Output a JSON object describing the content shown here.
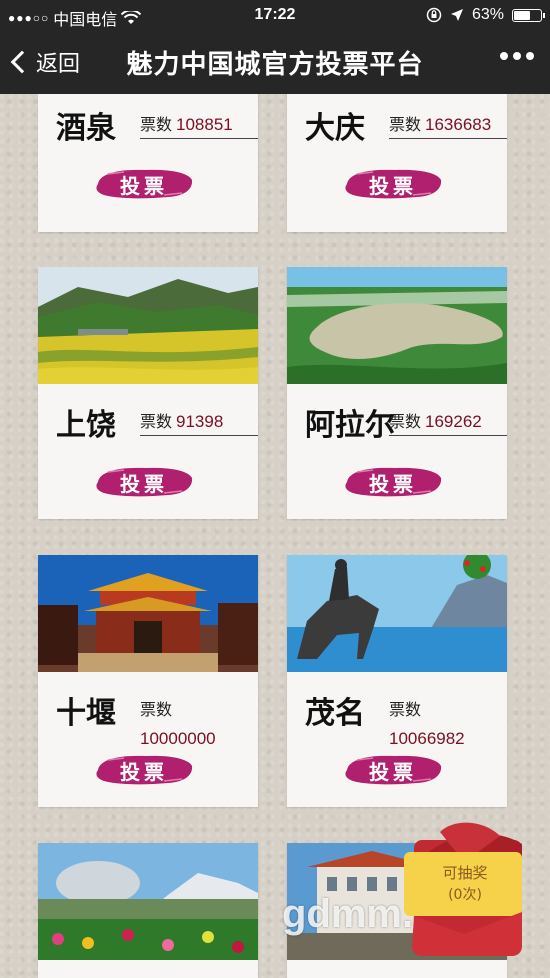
{
  "status_bar": {
    "carrier": "中国电信",
    "time": "17:22",
    "battery": "63%",
    "battery_level": 0.63
  },
  "nav": {
    "back_label": "返回",
    "title": "魅力中国城官方投票平台"
  },
  "vote_word": "票数",
  "vote_button_label": "投票",
  "cards": [
    {
      "city": "酒泉",
      "votes": "108851"
    },
    {
      "city": "大庆",
      "votes": "1636683"
    },
    {
      "city": "上饶",
      "votes": "91398"
    },
    {
      "city": "阿拉尔",
      "votes": "169262"
    },
    {
      "city": "十堰",
      "votes": "10000000"
    },
    {
      "city": "茂名",
      "votes": "10066982"
    }
  ],
  "lottery": {
    "line1": "可抽奖",
    "line2": "(0次)"
  },
  "watermark": "gdmm.com",
  "colors": {
    "nav_bg": "#262626",
    "vote_brush": "#b0206e",
    "vote_number": "#7a1020",
    "envelope_red": "#d02d35"
  }
}
